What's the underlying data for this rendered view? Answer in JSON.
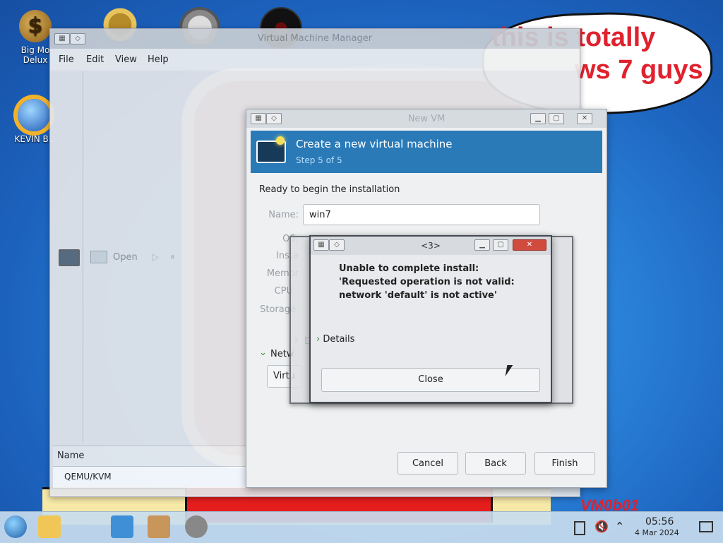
{
  "desktop": {
    "icons": [
      {
        "label_line1": "Big Mo",
        "label_line2": "Delux"
      },
      {
        "label_line1": "KEVIN BL",
        "label_line2": ""
      }
    ],
    "money_symbol": "$",
    "speech_bubble": [
      "this is totally",
      "ws 7 guys"
    ],
    "watermark": "VM0b01"
  },
  "manager": {
    "title": "Virtual Machine Manager",
    "menu": [
      "File",
      "Edit",
      "View",
      "Help"
    ],
    "open_label": "Open",
    "list_header": "Name",
    "list_row": "QEMU/KVM"
  },
  "new_vm": {
    "title": "New VM",
    "header_title": "Create a new virtual machine",
    "header_step": "Step 5 of 5",
    "ready_text": "Ready to begin the installation",
    "name_label": "Name:",
    "name_value": "win7",
    "os_label": "OS:",
    "install_label": "Insta",
    "memory_label": "Memor",
    "cpu_label": "CPU",
    "storage_label": "Storage",
    "network_label": "Netw",
    "network_value": "Virtu",
    "details_collapsed_label": "D",
    "buttons": {
      "cancel": "Cancel",
      "back": "Back",
      "finish": "Finish"
    }
  },
  "error_dialog": {
    "title": "<3>",
    "message": "Unable to complete install: 'Requested operation is not valid: network 'default' is not active'",
    "details_label": "Details",
    "close_label": "Close"
  },
  "taskbar": {
    "time": "05:56",
    "date": "4 Mar 2024"
  },
  "colors": {
    "wizard_header": "#2a7ab8",
    "error_close_red": "#d04a3e",
    "speech_text": "#e0212e"
  }
}
